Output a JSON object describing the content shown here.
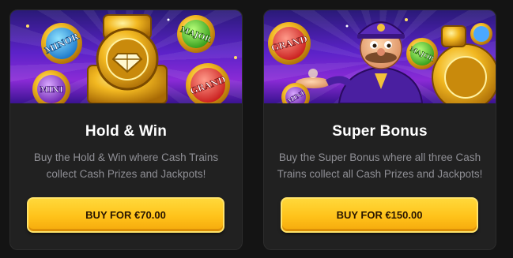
{
  "cards": [
    {
      "title": "Hold & Win",
      "description": "Buy the Hold & Win where Cash Trains collect Cash Prizes and Jackpots!",
      "button_label": "BUY FOR €70.00",
      "art_badges": [
        "MINOR",
        "MAJOR",
        "MINI",
        "GRAND"
      ]
    },
    {
      "title": "Super Bonus",
      "description": "Buy the Super Bonus where all three Cash Trains collect all Cash Prizes and Jackpots!",
      "button_label": "BUY FOR €150.00",
      "art_badges": [
        "GRAND",
        "MAJOR",
        "MINI"
      ]
    }
  ],
  "colors": {
    "background": "#141414",
    "card": "#212121",
    "button": "#ffc21a",
    "art_purple": "#5b22c8"
  }
}
